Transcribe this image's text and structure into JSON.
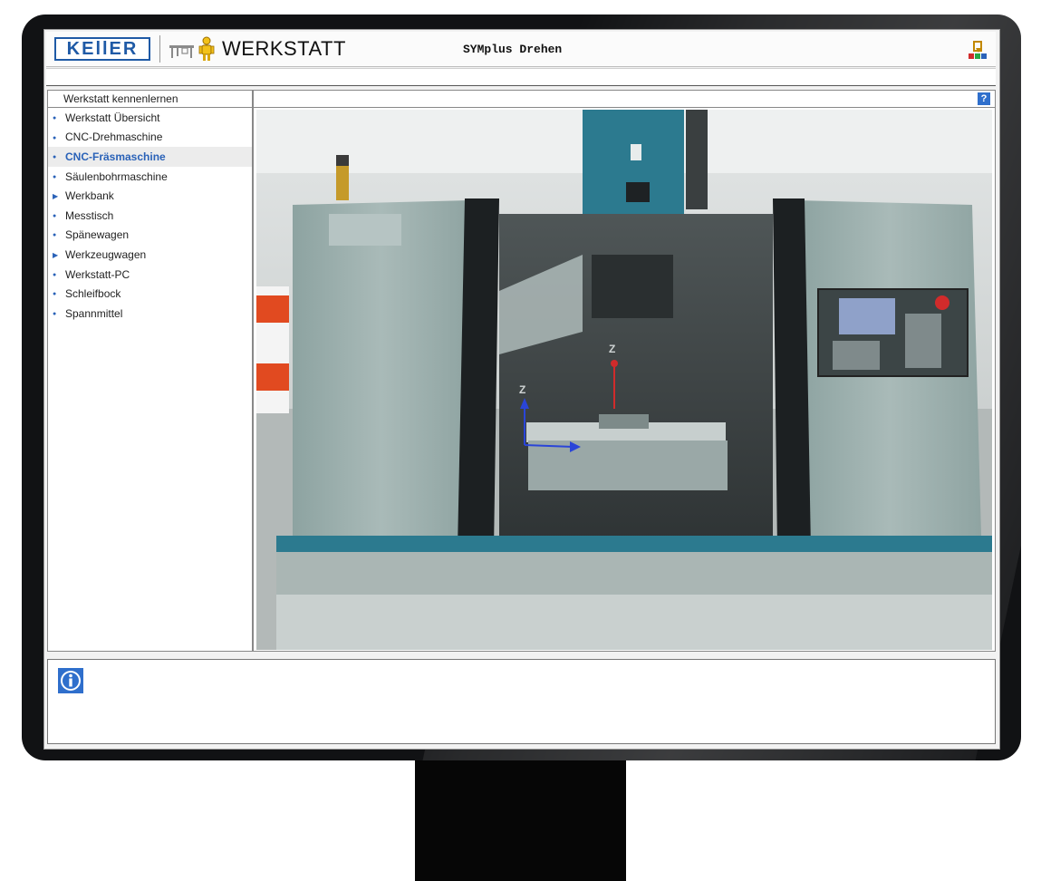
{
  "header": {
    "logo_text": "KEllER",
    "app_title": "WERKSTATT",
    "mode_title": "SYMplus Drehen"
  },
  "sidebar": {
    "title": "Werkstatt kennenlernen",
    "items": [
      {
        "label": "Werkstatt Übersicht",
        "marker": "dot",
        "active": false
      },
      {
        "label": "CNC-Drehmaschine",
        "marker": "dot",
        "active": false
      },
      {
        "label": "CNC-Fräsmaschine",
        "marker": "dot",
        "active": true
      },
      {
        "label": "Säulenbohrmaschine",
        "marker": "dot",
        "active": false
      },
      {
        "label": "Werkbank",
        "marker": "triangle",
        "active": false
      },
      {
        "label": "Messtisch",
        "marker": "dot",
        "active": false
      },
      {
        "label": "Spänewagen",
        "marker": "dot",
        "active": false
      },
      {
        "label": "Werkzeugwagen",
        "marker": "triangle",
        "active": false
      },
      {
        "label": "Werkstatt-PC",
        "marker": "dot",
        "active": false
      },
      {
        "label": "Schleifbock",
        "marker": "dot",
        "active": false
      },
      {
        "label": "Spannmittel",
        "marker": "dot",
        "active": false
      }
    ]
  },
  "content": {
    "help_label": "?",
    "scene_axis_labels": [
      "Z",
      "Z"
    ]
  },
  "colors": {
    "accent": "#2a62b8",
    "machine_body": "#9fb3b1",
    "machine_teal": "#2c7a8f"
  },
  "icons": [
    "bench-icon",
    "worker-icon",
    "exit-icon",
    "help-icon",
    "info-icon"
  ]
}
